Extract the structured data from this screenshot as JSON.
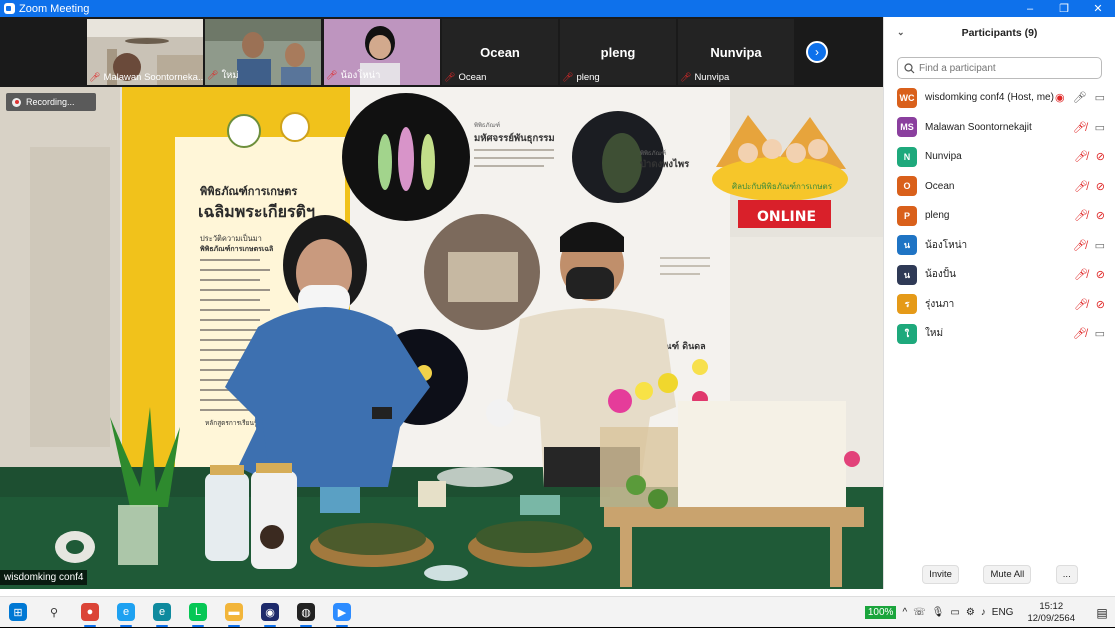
{
  "window": {
    "title": "Zoom Meeting",
    "controls": [
      "–",
      "❐",
      "✕"
    ]
  },
  "gallery_strip": {
    "tiles": [
      {
        "name": "Malawan Soontorneka...",
        "kind": "video",
        "muted": true
      },
      {
        "name": "ใหม่",
        "kind": "video",
        "muted": true
      },
      {
        "name": "น้องโหน่า",
        "kind": "video",
        "muted": true
      },
      {
        "name": "Ocean",
        "display": "Ocean",
        "kind": "name",
        "muted": true
      },
      {
        "name": "pleng",
        "display": "pleng",
        "kind": "name",
        "muted": true
      },
      {
        "name": "Nunvipa",
        "display": "Nunvipa",
        "kind": "name",
        "muted": true
      }
    ],
    "next_label": "›"
  },
  "main_video": {
    "recording_label": "Recording...",
    "speaker_name": "wisdomking conf4",
    "scene_text": {
      "museum_title_1": "พิพิธภัณฑ์การเกษตร",
      "museum_title_2": "เฉลิมพระเกียรติฯ",
      "panel_heading_1": "พิพิธภัณฑ์",
      "panel_heading_1b": "มหัศจรรย์พันธุกรรม",
      "panel_heading_2": "พิพิธภัณฑ์",
      "panel_heading_2b": "ป่าดงพงไพร",
      "panel_heading_3": "พิพิธภัณฑ์ ดินดล",
      "online_label": "ONLINE",
      "banner_thai": "ศิลปะกับพิพิธภัณฑ์การเกษตร",
      "section_1": "ประวัติความเป็นมา",
      "section_1b": "พิพิธภัณฑ์การเกษตรเฉลิ",
      "section_2": "หลักสูตรการเรียนรู้"
    }
  },
  "participants_panel": {
    "title": "Participants (9)",
    "search_placeholder": "Find a participant",
    "participants": [
      {
        "initials": "WC",
        "name": "wisdomking conf4 (Host, me)",
        "color": "#d9601b",
        "recording": true,
        "mic": "on",
        "cam": "on"
      },
      {
        "initials": "MS",
        "name": "Malawan Soontornekajit",
        "color": "#8a3f9e",
        "recording": false,
        "mic": "off",
        "cam": "on"
      },
      {
        "initials": "N",
        "name": "Nunvipa",
        "color": "#1ea97c",
        "recording": false,
        "mic": "off",
        "cam": "off"
      },
      {
        "initials": "O",
        "name": "Ocean",
        "color": "#d9601b",
        "recording": false,
        "mic": "off",
        "cam": "off"
      },
      {
        "initials": "P",
        "name": "pleng",
        "color": "#d9601b",
        "recording": false,
        "mic": "off",
        "cam": "off"
      },
      {
        "initials": "น",
        "name": "น้องโหน่า",
        "color": "#1f74c4",
        "recording": false,
        "mic": "off",
        "cam": "on"
      },
      {
        "initials": "น",
        "name": "น้องปั้น",
        "color": "#2f3a56",
        "recording": false,
        "mic": "off",
        "cam": "off"
      },
      {
        "initials": "ร",
        "name": "รุ่งนภา",
        "color": "#e59a18",
        "recording": false,
        "mic": "off",
        "cam": "off"
      },
      {
        "initials": "ใ",
        "name": "ใหม่",
        "color": "#1ea97c",
        "recording": false,
        "mic": "off",
        "cam": "on"
      }
    ],
    "invite_label": "Invite",
    "mute_all_label": "Mute All",
    "more_label": "..."
  },
  "taskbar": {
    "apps": [
      {
        "name": "windows-start-icon",
        "glyph": "⊞",
        "color": "#0078d4"
      },
      {
        "name": "search-icon",
        "glyph": "⚲",
        "color": "#333"
      },
      {
        "name": "chrome-icon",
        "glyph": "●",
        "color": "#db4437"
      },
      {
        "name": "ie-icon",
        "glyph": "e",
        "color": "#1ea1f1"
      },
      {
        "name": "edge-icon",
        "glyph": "e",
        "color": "#0f8a9e"
      },
      {
        "name": "line-icon",
        "glyph": "L",
        "color": "#06c755"
      },
      {
        "name": "file-explorer-icon",
        "glyph": "▬",
        "color": "#f2b53a"
      },
      {
        "name": "zoom-alt-icon",
        "glyph": "◉",
        "color": "#1d2a6b"
      },
      {
        "name": "obs-icon",
        "glyph": "◍",
        "color": "#222"
      },
      {
        "name": "zoom-icon",
        "glyph": "▶",
        "color": "#2d8cff"
      }
    ],
    "battery": "100%",
    "language": "ENG",
    "time": "15:12",
    "date": "12/09/2564",
    "tray_icons": [
      "^",
      "☏",
      "🎙",
      "▭",
      "⚙",
      "♪"
    ]
  }
}
